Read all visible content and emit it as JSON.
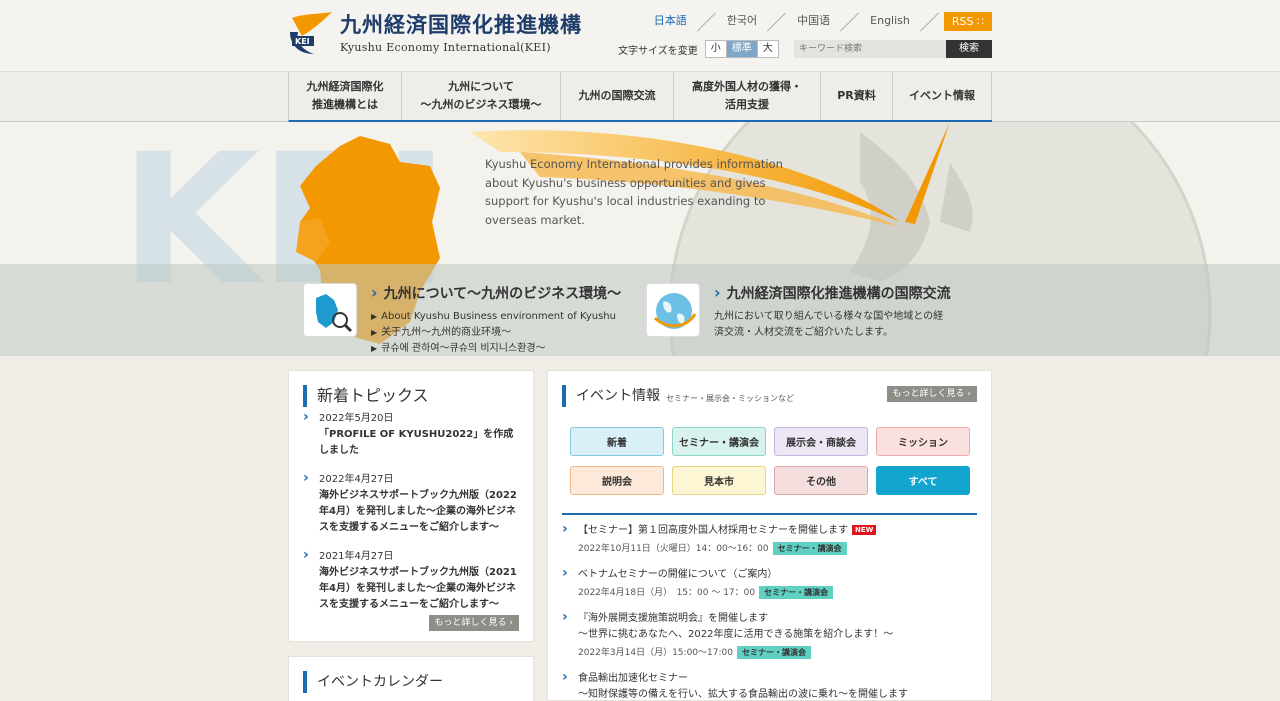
{
  "site": {
    "title_jp": "九州経済国際化推進機構",
    "title_en": "Kyushu Economy International(KEI)",
    "logo_badge": "KEI"
  },
  "languages": [
    {
      "label": "日本語",
      "active": true
    },
    {
      "label": "한국어",
      "active": false
    },
    {
      "label": "中国语",
      "active": false
    },
    {
      "label": "English",
      "active": false
    }
  ],
  "rss_label": "RSS",
  "font_size": {
    "label": "文字サイズを変更",
    "options": [
      "小",
      "標準",
      "大"
    ],
    "selected": "標準"
  },
  "search": {
    "placeholder": "キーワード検索",
    "button": "検索"
  },
  "nav": [
    {
      "label": "九州経済国際化\n推進機構とは"
    },
    {
      "label": "九州について\n〜九州のビジネス環境〜"
    },
    {
      "label": "九州の国際交流"
    },
    {
      "label": "高度外国人材の獲得・\n活用支援"
    },
    {
      "label": "PR資料"
    },
    {
      "label": "イベント情報"
    }
  ],
  "hero": {
    "text": "Kyushu Economy International provides information about Kyushu's business opportunities and gives support for Kyushu's local industries exanding to overseas market.",
    "watermark": "KEI",
    "panels": [
      {
        "title": "九州について〜九州のビジネス環境〜",
        "icon": "kyushu-map-magnifier-icon",
        "lines": [
          "About Kyushu Business environment of Kyushu",
          "关于九州〜九州的商业环境〜",
          "큐슈에 관하여〜큐슈의 비지니스환경〜"
        ]
      },
      {
        "title": "九州経済国際化推進機構の国際交流",
        "icon": "globe-icon",
        "lines": [
          "九州において取り組んでいる様々な国や地域との経",
          "済交流・人材交流をご紹介いたします。"
        ]
      }
    ]
  },
  "topics": {
    "title": "新着トピックス",
    "items": [
      {
        "date": "2022年5月20日",
        "text": "「PROFILE OF KYUSHU2022」を作成しました"
      },
      {
        "date": "2022年4月27日",
        "text": "海外ビジネスサポートブック九州版（2022年4月）を発刊しました〜企業の海外ビジネスを支援するメニューをご紹介します〜"
      },
      {
        "date": "2021年4月27日",
        "text": "海外ビジネスサポートブック九州版（2021年4月）を発刊しました〜企業の海外ビジネスを支援するメニューをご紹介します〜"
      }
    ],
    "more": "もっと詳しく見る"
  },
  "calendar": {
    "title": "イベントカレンダー"
  },
  "events": {
    "title": "イベント情報",
    "subtitle": "セミナー・展示会・ミッションなど",
    "more": "もっと詳しく見る",
    "categories": [
      {
        "label": "新着",
        "bg": "#d9f0f9",
        "border": "#86c9e3",
        "color": "#333333"
      },
      {
        "label": "セミナー・講演会",
        "bg": "#d8f2ee",
        "border": "#8cd4c9",
        "color": "#333333"
      },
      {
        "label": "展示会・商談会",
        "bg": "#ece6f5",
        "border": "#c5b6df",
        "color": "#333333"
      },
      {
        "label": "ミッション",
        "bg": "#fbe0e0",
        "border": "#eda9a9",
        "color": "#333333"
      },
      {
        "label": "説明会",
        "bg": "#fde9d9",
        "border": "#f1b98a",
        "color": "#333333"
      },
      {
        "label": "見本市",
        "bg": "#fdf6d4",
        "border": "#e6d584",
        "color": "#333333"
      },
      {
        "label": "その他",
        "bg": "#f4dede",
        "border": "#d9a9a9",
        "color": "#333333"
      },
      {
        "label": "すべて",
        "bg": "#12a6cf",
        "border": "#12a6cf",
        "color": "#ffffff"
      }
    ],
    "items": [
      {
        "name": "【セミナー】第１回高度外国人材採用セミナーを開催します",
        "new": "NEW",
        "date": "2022年10月11日（火曜日）14：00〜16：00",
        "badge": "セミナー・講演会"
      },
      {
        "name": "ベトナムセミナーの開催について（ご案内）",
        "date": "2022年4月18日（月）　15：00 〜 17：00",
        "badge": "セミナー・講演会"
      },
      {
        "name": "『海外展開支援施策説明会』を開催します\n〜世界に挑むあなたへ、2022年度に活用できる施策を紹介します！〜",
        "date": "2022年3月14日（月）15:00〜17:00",
        "badge": "セミナー・講演会"
      },
      {
        "name": "食品輸出加速化セミナー\n〜知財保護等の備えを行い、拡大する食品輸出の波に乗れ〜を開催します",
        "date": "",
        "badge": ""
      }
    ]
  },
  "colors": {
    "brand_blue": "#1f6ab0",
    "accent_orange": "#f39800"
  }
}
